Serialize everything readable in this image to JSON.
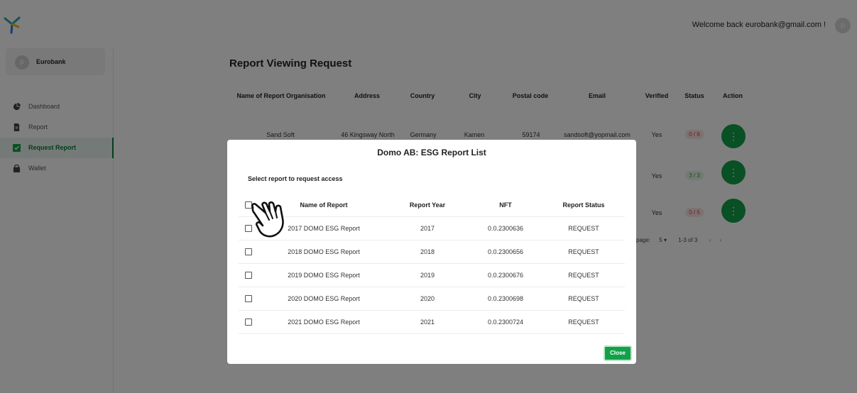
{
  "header": {
    "welcome_text": "Welcome back eurobank@gmail.com !",
    "avatar_letter": "p"
  },
  "sidebar": {
    "org_avatar_letter": "p",
    "org_name": "Eurobank",
    "items": [
      {
        "label": "Dashboard",
        "icon": "pie-chart-icon"
      },
      {
        "label": "Report",
        "icon": "document-icon"
      },
      {
        "label": "Request Report",
        "icon": "checkbox-icon",
        "active": true
      },
      {
        "label": "Wallet",
        "icon": "wallet-icon"
      }
    ]
  },
  "main": {
    "title": "Report Viewing Request",
    "columns": [
      "Name of Report Organisation",
      "Address",
      "Country",
      "City",
      "Postal code",
      "Email",
      "Verified",
      "Status",
      "Action"
    ],
    "rows": [
      {
        "organisation": "Sand Soft",
        "address": "46 Kingsway North",
        "country": "Germany",
        "city": "Kamen",
        "postal_code": "59174",
        "email": "sandsoft@yopmail.com",
        "verified": "Yes",
        "status": "0 / 6",
        "status_color": "#c54545"
      },
      {
        "verified": "Yes",
        "status": "3 / 3",
        "status_color": "#2e9b45"
      },
      {
        "verified": "Yes",
        "status": "0 / 5",
        "status_color": "#c54545"
      }
    ],
    "pagination": {
      "rows_per_page_label": "page:",
      "rows_per_page_value": "5",
      "range": "1-3 of 3"
    }
  },
  "modal": {
    "title": "Domo AB: ESG Report List",
    "subtitle": "Select report to request access",
    "columns": [
      "Name of Report",
      "Report Year",
      "NFT",
      "Report Status"
    ],
    "rows": [
      {
        "name": "2017 DOMO ESG Report",
        "year": "2017",
        "nft": "0.0.2300636",
        "status": "REQUEST"
      },
      {
        "name": "2018 DOMO ESG Report",
        "year": "2018",
        "nft": "0.0.2300656",
        "status": "REQUEST"
      },
      {
        "name": "2019 DOMO ESG Report",
        "year": "2019",
        "nft": "0.0.2300676",
        "status": "REQUEST"
      },
      {
        "name": "2020 DOMO ESG Report",
        "year": "2020",
        "nft": "0.0.2300698",
        "status": "REQUEST"
      },
      {
        "name": "2021 DOMO ESG Report",
        "year": "2021",
        "nft": "0.0.2300724",
        "status": "REQUEST"
      }
    ],
    "close_label": "Close"
  },
  "colors": {
    "accent": "#12a049",
    "accent_dark": "#0c7a3c",
    "overlay": "rgba(0,0,0,0.5)"
  }
}
